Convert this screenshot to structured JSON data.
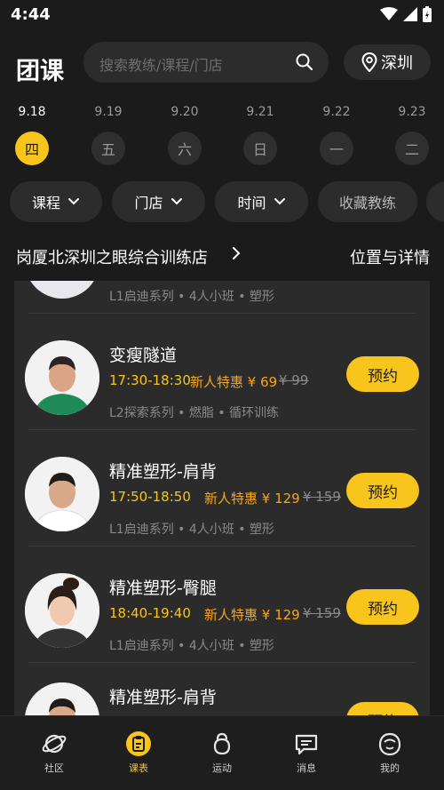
{
  "status": {
    "time": "4:44"
  },
  "header": {
    "title": "团课",
    "search_placeholder": "搜索教练/课程/门店",
    "city": "深圳"
  },
  "dates": [
    {
      "date": "9.18",
      "day": "四",
      "active": true
    },
    {
      "date": "9.19",
      "day": "五",
      "active": false
    },
    {
      "date": "9.20",
      "day": "六",
      "active": false
    },
    {
      "date": "9.21",
      "day": "日",
      "active": false
    },
    {
      "date": "9.22",
      "day": "一",
      "active": false
    },
    {
      "date": "9.23",
      "day": "二",
      "active": false
    }
  ],
  "filters": {
    "course": "课程",
    "store": "门店",
    "time": "时间",
    "favorite": "收藏教练"
  },
  "store": {
    "name": "岗厦北深圳之眼综合训练店",
    "detail": "位置与详情"
  },
  "classes": [
    {
      "name": "",
      "time": "",
      "promo": "",
      "old_price": "",
      "meta": "L1启迪系列 • 4人小班 • 塑形",
      "book": ""
    },
    {
      "name": "变瘦隧道",
      "time": "17:30-18:30",
      "promo": "新人特惠 ¥ 69",
      "old_price": "¥ 99",
      "meta": "L2探索系列 • 燃脂 • 循环训练",
      "book": "预约"
    },
    {
      "name": "精准塑形-肩背",
      "time": "17:50-18:50",
      "promo": "新人特惠 ¥ 129",
      "old_price": "¥ 159",
      "meta": "L1启迪系列 • 4人小班 • 塑形",
      "book": "预约"
    },
    {
      "name": "精准塑形-臀腿",
      "time": "18:40-19:40",
      "promo": "新人特惠 ¥ 129",
      "old_price": "¥ 159",
      "meta": "L1启迪系列 • 4人小班 • 塑形",
      "book": "预约"
    },
    {
      "name": "精准塑形-肩背",
      "time": "",
      "promo": "",
      "old_price": "",
      "meta": "",
      "book": "预约"
    }
  ],
  "tabs": [
    {
      "label": "社区",
      "icon": "planet-icon"
    },
    {
      "label": "课表",
      "icon": "clipboard-icon"
    },
    {
      "label": "运动",
      "icon": "kettlebell-icon"
    },
    {
      "label": "消息",
      "icon": "message-icon"
    },
    {
      "label": "我的",
      "icon": "profile-icon"
    }
  ],
  "colors": {
    "accent": "#f8c51c",
    "background": "#1b1b1b",
    "card": "#2b2b2b"
  }
}
